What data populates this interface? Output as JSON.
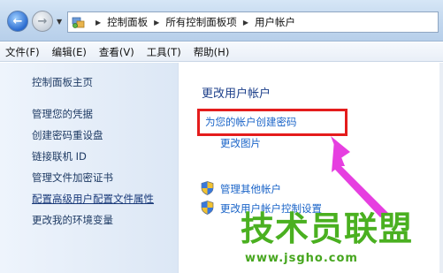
{
  "address_bar": {
    "breadcrumbs": [
      "控制面板",
      "所有控制面板项",
      "用户帐户"
    ]
  },
  "menu": {
    "items": [
      "文件(F)",
      "编辑(E)",
      "查看(V)",
      "工具(T)",
      "帮助(H)"
    ]
  },
  "left_pane": {
    "home": "控制面板主页",
    "links": [
      "管理您的凭据",
      "创建密码重设盘",
      "链接联机 ID",
      "管理文件加密证书",
      "配置高级用户配置文件属性",
      "更改我的环境变量"
    ]
  },
  "main": {
    "title": "更改用户帐户",
    "create_password": "为您的帐户创建密码",
    "change_picture": "更改图片",
    "manage_accounts": "管理其他帐户",
    "uac_settings": "更改用户帐户控制设置"
  },
  "watermark": {
    "title": "技术员联盟",
    "url": "www.jsgho.com"
  },
  "colors": {
    "link": "#1a64c8",
    "title": "#1c3f8a",
    "highlight": "#e41c1c",
    "arrow": "#e63fe0",
    "watermark": "#4ab020"
  }
}
